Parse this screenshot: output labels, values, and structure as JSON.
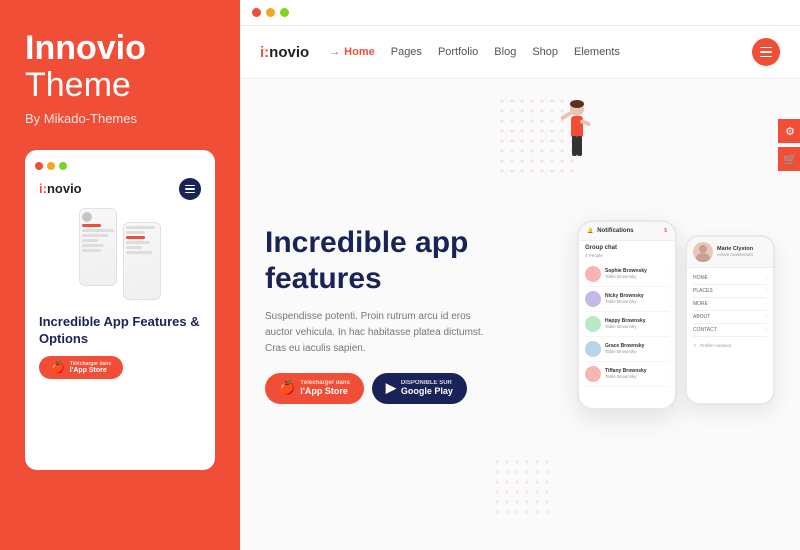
{
  "left": {
    "title_bold": "Innovio",
    "title_light": "Theme",
    "by": "By Mikado-Themes",
    "card": {
      "logo": "i:novio",
      "mobile_title": "Incredible App Features & Options",
      "appstore_label_small": "Télécharger dans",
      "appstore_label_main": "l'App Store"
    }
  },
  "right": {
    "browser_title": "",
    "nav": {
      "logo": "i:novio",
      "arrow": "→",
      "items": [
        "Home",
        "Pages",
        "Portfolio",
        "Blog",
        "Shop",
        "Elements"
      ]
    },
    "hero": {
      "title_line1": "Incredible app",
      "title_line2": "features",
      "description": "Suspendisse potenti. Proin rutrum arcu id eros auctor vehicula.\nIn hac habitasse platea dictumst. Cras eu iaculis sapien.",
      "btn_appstore_small": "Télécharger dans",
      "btn_appstore_main": "l'App Store",
      "btn_google_small": "DISPONIBLE SUR",
      "btn_google_main": "Google Play"
    },
    "phone_big": {
      "header": "Notifications",
      "subheader": "5",
      "group_chat": "Group chat",
      "group_count": "4 People",
      "contacts": [
        {
          "name": "Sophie Brownsky",
          "msg": "Table Brownsky",
          "color": "pink"
        },
        {
          "name": "Nicky Brownsky",
          "msg": "Table Brownsky",
          "color": "purple"
        },
        {
          "name": "Happy Brownsky",
          "msg": "Table Brownsky",
          "color": "green"
        },
        {
          "name": "Grace Brownsky",
          "msg": "Table Brownsky",
          "color": "blue"
        },
        {
          "name": "Tiffany Brownsky",
          "msg": "Table Brownsky",
          "color": "pink"
        }
      ]
    },
    "phone_small": {
      "contact_name": "Marie Clyston",
      "contact_status": "Active maintenant",
      "menu_items": [
        "HOME",
        "PLACES",
        "MORE",
        "ABOUT",
        "CONTACT"
      ],
      "profile_label": "Profile connexe"
    }
  },
  "colors": {
    "accent": "#F04E37",
    "dark": "#1a2357",
    "white": "#ffffff",
    "light_bg": "#fafafa"
  },
  "icons": {
    "apple": "🍎",
    "google_play": "▶",
    "menu": "☰",
    "cart": "🛒",
    "chevron": "›"
  }
}
